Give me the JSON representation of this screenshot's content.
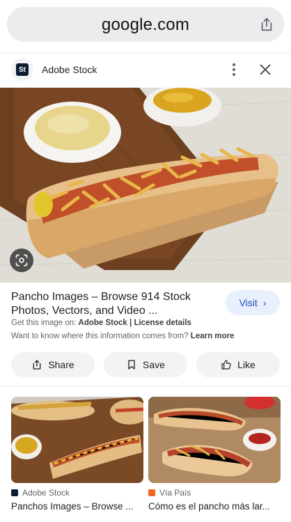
{
  "browser": {
    "url": "google.com",
    "share_icon": "share-icon"
  },
  "source": {
    "logo_text": "St",
    "name": "Adobe Stock",
    "more_icon": "more-vert-icon",
    "close_icon": "close-icon"
  },
  "image": {
    "description_icon": "lens-icon"
  },
  "result": {
    "title": "Pancho Images – Browse 914 Stock Photos, Vectors, and Video ...",
    "visit_label": "Visit",
    "get_image_prefix": "Get this image on:",
    "get_image_source": "Adobe Stock",
    "separator": "|",
    "license_label": "License details",
    "know_more_text": "Want to know where this information comes from?",
    "learn_more_label": "Learn more"
  },
  "actions": {
    "share_label": "Share",
    "save_label": "Save",
    "like_label": "Like"
  },
  "related": [
    {
      "source": "Adobe Stock",
      "title": "Panchos Images – Browse ..."
    },
    {
      "source": "Vía País",
      "title": "Cómo es el pancho más lar..."
    }
  ],
  "colors": {
    "accent": "#1a4fb8",
    "visit_bg": "#e8f0fe",
    "button_bg": "#f1f3f4",
    "adobe_stock": "#0b1d33",
    "via_pais": "#f26522"
  }
}
